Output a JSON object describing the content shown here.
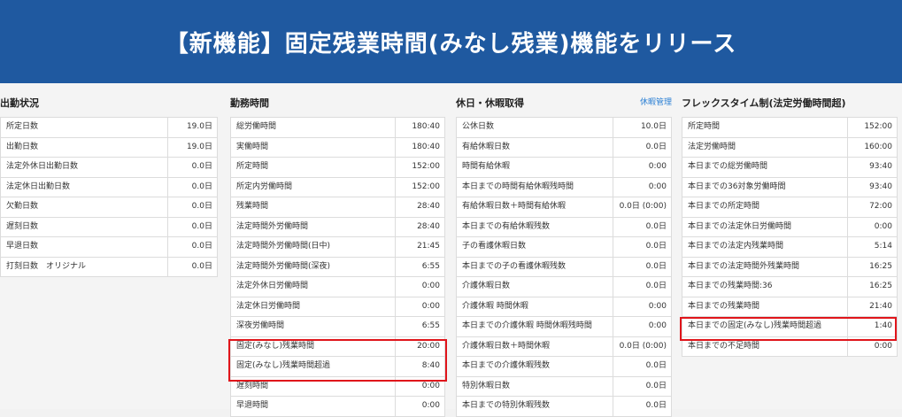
{
  "banner": {
    "title": "【新機能】固定残業時間(みなし残業)機能をリリース"
  },
  "sections": [
    {
      "title": "出勤状況",
      "rows": [
        {
          "label": "所定日数",
          "value": "19.0日"
        },
        {
          "label": "出勤日数",
          "value": "19.0日"
        },
        {
          "label": "法定外休日出勤日数",
          "value": "0.0日"
        },
        {
          "label": "法定休日出勤日数",
          "value": "0.0日"
        },
        {
          "label": "欠勤日数",
          "value": "0.0日"
        },
        {
          "label": "遅刻日数",
          "value": "0.0日"
        },
        {
          "label": "早退日数",
          "value": "0.0日"
        },
        {
          "label": "打刻日数　オリジナル",
          "value": "0.0日"
        }
      ]
    },
    {
      "title": "勤務時間",
      "rows": [
        {
          "label": "総労働時間",
          "value": "180:40"
        },
        {
          "label": "実働時間",
          "value": "180:40"
        },
        {
          "label": "所定時間",
          "value": "152:00"
        },
        {
          "label": "所定内労働時間",
          "value": "152:00"
        },
        {
          "label": "残業時間",
          "value": "28:40"
        },
        {
          "label": "法定時間外労働時間",
          "value": "28:40"
        },
        {
          "label": "法定時間外労働時間(日中)",
          "value": "21:45"
        },
        {
          "label": "法定時間外労働時間(深夜)",
          "value": "6:55"
        },
        {
          "label": "法定外休日労働時間",
          "value": "0:00"
        },
        {
          "label": "法定休日労働時間",
          "value": "0:00"
        },
        {
          "label": "深夜労働時間",
          "value": "6:55"
        },
        {
          "label": "固定(みなし)残業時間",
          "value": "20:00"
        },
        {
          "label": "固定(みなし)残業時間超過",
          "value": "8:40"
        },
        {
          "label": "遅刻時間",
          "value": "0:00"
        },
        {
          "label": "早退時間",
          "value": "0:00"
        }
      ]
    },
    {
      "title": "休日・休暇取得",
      "link": "休暇管理",
      "rows": [
        {
          "label": "公休日数",
          "value": "10.0日"
        },
        {
          "label": "有給休暇日数",
          "value": "0.0日"
        },
        {
          "label": "時間有給休暇",
          "value": "0:00"
        },
        {
          "label": "本日までの時間有給休暇残時間",
          "value": "0:00"
        },
        {
          "label": "有給休暇日数＋時間有給休暇",
          "value": "0.0日 (0:00)"
        },
        {
          "label": "本日までの有給休暇残数",
          "value": "0.0日"
        },
        {
          "label": "子の看護休暇日数",
          "value": "0.0日"
        },
        {
          "label": "本日までの子の看護休暇残数",
          "value": "0.0日"
        },
        {
          "label": "介護休暇日数",
          "value": "0.0日"
        },
        {
          "label": "介護休暇 時間休暇",
          "value": "0:00"
        },
        {
          "label": "本日までの介護休暇 時間休暇残時間",
          "value": "0:00"
        },
        {
          "label": "介護休暇日数＋時間休暇",
          "value": "0.0日 (0:00)"
        },
        {
          "label": "本日までの介護休暇残数",
          "value": "0.0日"
        },
        {
          "label": "特別休暇日数",
          "value": "0.0日"
        },
        {
          "label": "本日までの特別休暇残数",
          "value": "0.0日"
        }
      ]
    },
    {
      "title": "フレックスタイム制(法定労働時間超)",
      "rows": [
        {
          "label": "所定時間",
          "value": "152:00"
        },
        {
          "label": "法定労働時間",
          "value": "160:00"
        },
        {
          "label": "本日までの総労働時間",
          "value": "93:40"
        },
        {
          "label": "本日までの36対象労働時間",
          "value": "93:40"
        },
        {
          "label": "本日までの所定時間",
          "value": "72:00"
        },
        {
          "label": "本日までの法定休日労働時間",
          "value": "0:00"
        },
        {
          "label": "本日までの法定内残業時間",
          "value": "5:14"
        },
        {
          "label": "本日までの法定時間外残業時間",
          "value": "16:25"
        },
        {
          "label": "本日までの残業時間:36",
          "value": "16:25"
        },
        {
          "label": "本日までの残業時間",
          "value": "21:40"
        },
        {
          "label": "本日までの固定(みなし)残業時間超過",
          "value": "1:40"
        },
        {
          "label": "本日までの不足時間",
          "value": "0:00"
        }
      ]
    }
  ]
}
